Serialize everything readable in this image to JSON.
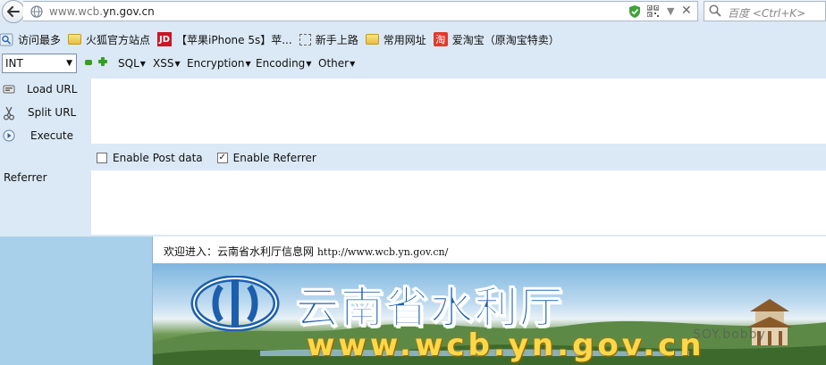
{
  "url_bar": {
    "url_prefix": "www.wcb.",
    "url_domain": "yn.gov.cn",
    "search_placeholder": "百度 <Ctrl+K>"
  },
  "bookmarks": [
    {
      "icon": "magnifier-icon",
      "label": "访问最多"
    },
    {
      "icon": "folder-icon",
      "label": "火狐官方站点"
    },
    {
      "icon": "jd-icon",
      "label": "【苹果iPhone 5s】苹..."
    },
    {
      "icon": "dashed-page-icon",
      "label": "新手上路"
    },
    {
      "icon": "folder-icon",
      "label": "常用网址"
    },
    {
      "icon": "taobao-icon",
      "label": "爱淘宝（原淘宝特卖）"
    }
  ],
  "hackbar": {
    "int_select": "INT",
    "menus": [
      "SQL",
      "XSS",
      "Encryption",
      "Encoding",
      "Other"
    ],
    "side_buttons": [
      "Load URL",
      "Split URL",
      "Execute"
    ],
    "url_value": "",
    "enable_post_label": "Enable Post data",
    "enable_post_checked": false,
    "enable_referrer_label": "Enable Referrer",
    "enable_referrer_checked": true,
    "referrer_label": "Referrer",
    "referrer_value": ""
  },
  "page": {
    "welcome_prefix": "欢迎进入：云南省水利厅信息网",
    "welcome_url": "http://www.wcb.yn.gov.cn/",
    "banner_title": "云南省水利厅",
    "banner_url": "www.wcb.yn.gov.cn",
    "banner_watermark": "SOY.bobby"
  },
  "colors": {
    "hackbar_bg": "#dbe8f5",
    "banner_title": "#1c5fae",
    "banner_url": "#ffd84a",
    "page_side_bg": "#a9d0ea"
  }
}
